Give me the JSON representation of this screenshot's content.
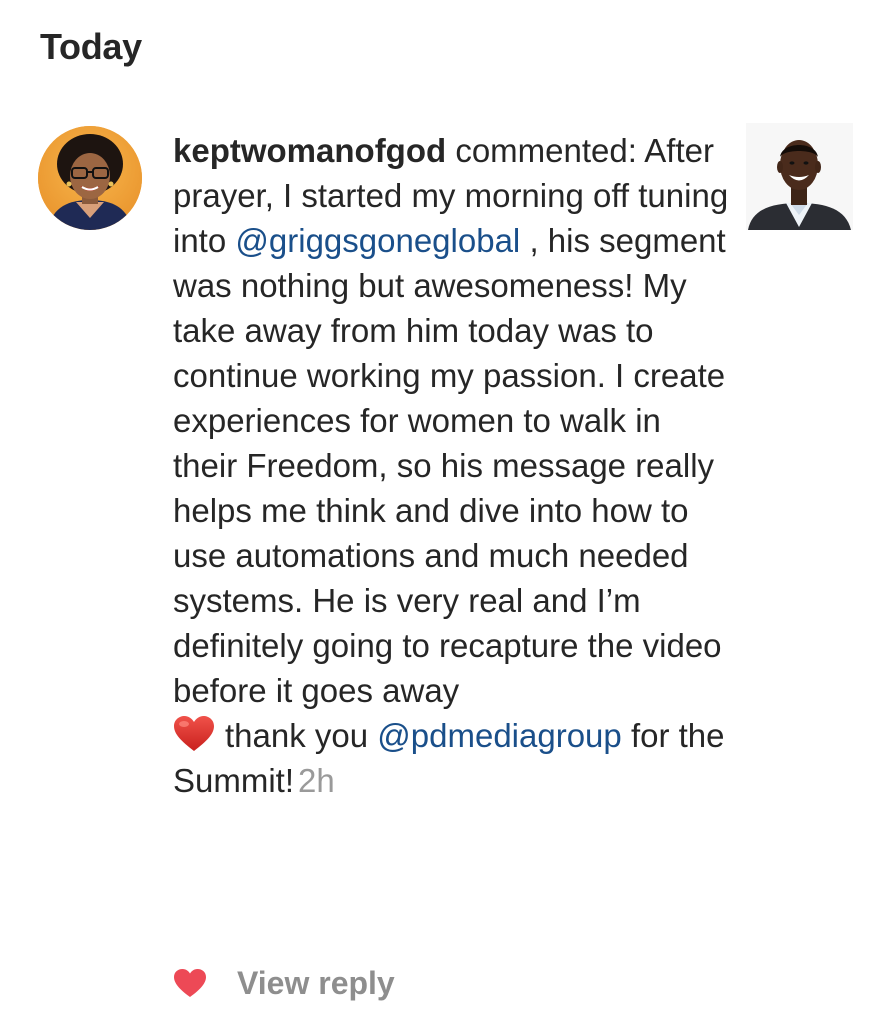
{
  "header": {
    "title": "Today"
  },
  "notification": {
    "username": "keptwomanofgod",
    "action": "commented:",
    "text_1": "After prayer, I started my morning off tuning into",
    "mention_1": "@griggsgoneglobal",
    "text_2": ", his segment was nothing but awesomeness! My take away from him today was to continue working my passion. I create experiences for women to walk in their Freedom, so his message really helps me think and dive into how to use automations and much needed systems. He is very real and I’m definitely going to recapture the video before it goes away",
    "text_3": "thank you",
    "mention_2": "@pdmediagroup",
    "text_4": "for the Summit!",
    "timestamp": "2h",
    "emoji": "red-heart",
    "avatar_icon": "user-avatar-photo",
    "post_thumbnail_icon": "post-thumbnail-photo"
  },
  "actions": {
    "like_icon": "heart-icon",
    "like_color": "#ed4956",
    "view_reply_label": "View reply"
  },
  "colors": {
    "text": "#262626",
    "mention": "#1a4f8a",
    "muted": "#8e8e8e",
    "timestamp": "#9a9a9a"
  }
}
